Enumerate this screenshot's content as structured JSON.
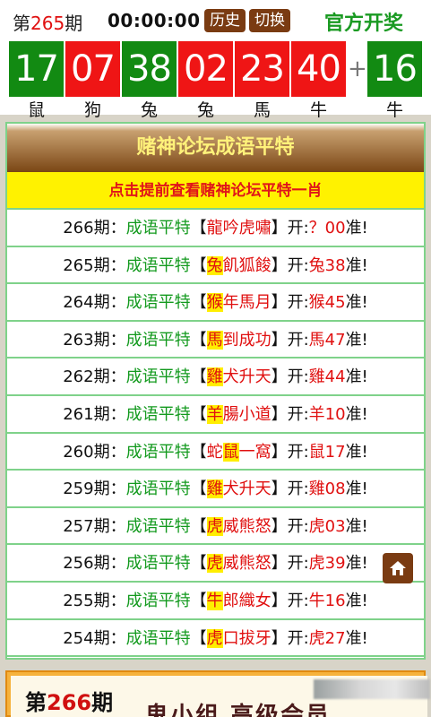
{
  "header": {
    "issue_prefix": "第",
    "issue_number": "265",
    "issue_suffix": "期",
    "timer": "00:00:00",
    "history_label": "历史",
    "switch_label": "切换",
    "official_label": "官方开奖"
  },
  "draw": {
    "balls": [
      {
        "number": "17",
        "zodiac": "鼠",
        "color": "green"
      },
      {
        "number": "07",
        "zodiac": "狗",
        "color": "red"
      },
      {
        "number": "38",
        "zodiac": "兔",
        "color": "green"
      },
      {
        "number": "02",
        "zodiac": "兔",
        "color": "red"
      },
      {
        "number": "23",
        "zodiac": "馬",
        "color": "red"
      },
      {
        "number": "40",
        "zodiac": "牛",
        "color": "red"
      }
    ],
    "plus": "+",
    "special": {
      "number": "16",
      "zodiac": "牛",
      "color": "green"
    }
  },
  "panel": {
    "title": "赌神论坛成语平特",
    "banner": "点击提前查看赌神论坛平特一肖",
    "rows": [
      {
        "period": "266期：",
        "label": "成语平特",
        "lb": "【",
        "hl": "",
        "idiom_rest": "龍吟虎嘯",
        "rb": "】",
        "open": "开:",
        "res_zodiac": "？",
        "res_num": "00",
        "zhun": "准!"
      },
      {
        "period": "265期：",
        "label": "成语平特",
        "lb": "【",
        "hl": "兔",
        "idiom_rest": "飢狐餕",
        "rb": "】",
        "open": "开:",
        "res_zodiac": "兔",
        "res_num": "38",
        "zhun": "准!"
      },
      {
        "period": "264期：",
        "label": "成语平特",
        "lb": "【",
        "hl": "猴",
        "idiom_rest": "年馬月",
        "rb": "】",
        "open": "开:",
        "res_zodiac": "猴",
        "res_num": "45",
        "zhun": "准!"
      },
      {
        "period": "263期：",
        "label": "成语平特",
        "lb": "【",
        "hl": "馬",
        "idiom_rest": "到成功",
        "rb": "】",
        "open": "开:",
        "res_zodiac": "馬",
        "res_num": "47",
        "zhun": "准!"
      },
      {
        "period": "262期：",
        "label": "成语平特",
        "lb": "【",
        "hl": "雞",
        "idiom_rest": "犬升天",
        "rb": "】",
        "open": "开:",
        "res_zodiac": "雞",
        "res_num": "44",
        "zhun": "准!"
      },
      {
        "period": "261期：",
        "label": "成语平特",
        "lb": "【",
        "hl": "羊",
        "idiom_rest": "腸小道",
        "rb": "】",
        "open": "开:",
        "res_zodiac": "羊",
        "res_num": "10",
        "zhun": "准!"
      },
      {
        "period": "260期：",
        "label": "成语平特",
        "lb": "【蛇",
        "hl": "鼠",
        "idiom_rest": "一窩",
        "rb": "】",
        "open": "开:",
        "res_zodiac": "鼠",
        "res_num": "17",
        "zhun": "准!"
      },
      {
        "period": "259期：",
        "label": "成语平特",
        "lb": "【",
        "hl": "雞",
        "idiom_rest": "犬升天",
        "rb": "】",
        "open": "开:",
        "res_zodiac": "雞",
        "res_num": "08",
        "zhun": "准!"
      },
      {
        "period": "257期：",
        "label": "成语平特",
        "lb": "【",
        "hl": "虎",
        "idiom_rest": "威熊怒",
        "rb": "】",
        "open": "开:",
        "res_zodiac": "虎",
        "res_num": "03",
        "zhun": "准!"
      },
      {
        "period": "256期：",
        "label": "成语平特",
        "lb": "【",
        "hl": "虎",
        "idiom_rest": "威熊怒",
        "rb": "】",
        "open": "开:",
        "res_zodiac": "虎",
        "res_num": "39",
        "zhun": "准!"
      },
      {
        "period": "255期：",
        "label": "成语平特",
        "lb": "【",
        "hl": "牛",
        "idiom_rest": "郎織女",
        "rb": "】",
        "open": "开:",
        "res_zodiac": "牛",
        "res_num": "16",
        "zhun": "准!"
      },
      {
        "period": "254期：",
        "label": "成语平特",
        "lb": "【",
        "hl": "虎",
        "idiom_rest": "口拔牙",
        "rb": "】",
        "open": "开:",
        "res_zodiac": "虎",
        "res_num": "27",
        "zhun": "准!"
      }
    ]
  },
  "home_icon": "home-icon",
  "footer": {
    "issue_prefix": "第",
    "issue_number": "266",
    "issue_suffix": "期",
    "title": "鬼小组 高级会员"
  },
  "colors": {
    "ball_green": "#128a12",
    "ball_red": "#ef1515",
    "accent_brown": "#7a3b12",
    "label_green": "#139a1e",
    "highlight_yellow": "#ffee00"
  }
}
